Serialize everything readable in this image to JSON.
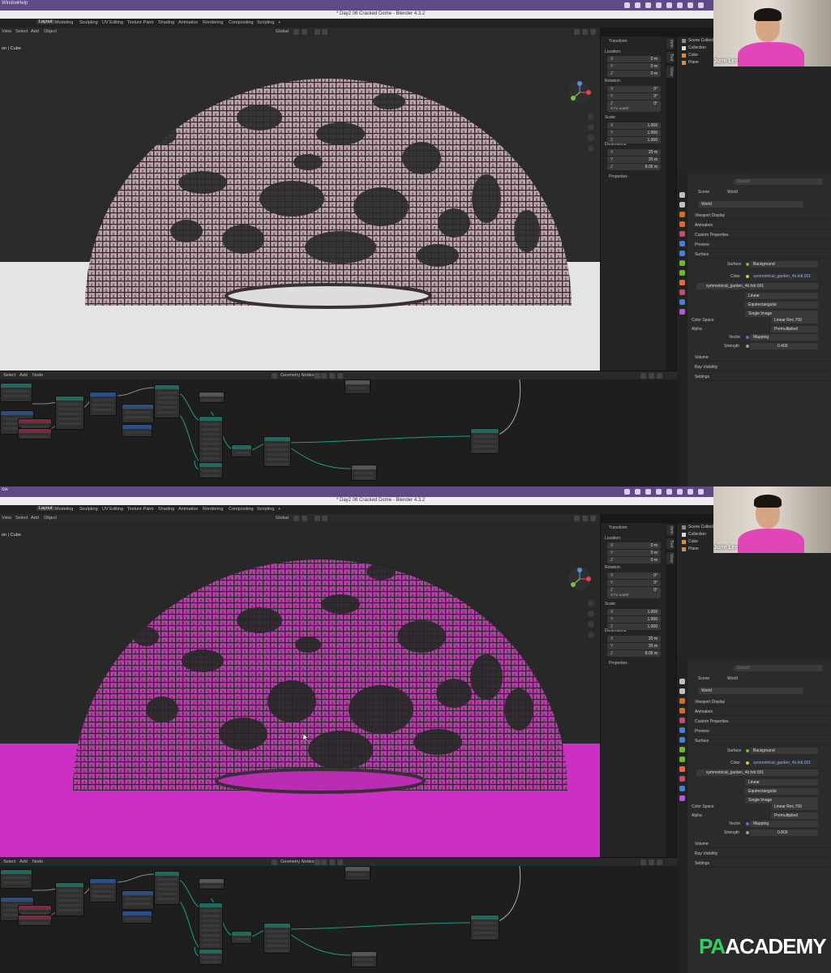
{
  "screens": [
    {
      "menu_left": "Window",
      "app_menu": "Help",
      "window_title": "* Day2 06 Cracked Dome - Blender 4.3.2",
      "workspace_tabs": [
        "Layout",
        "Modeling",
        "Sculpting",
        "UV Editing",
        "Texture Paint",
        "Shading",
        "Animation",
        "Rendering",
        "Compositing",
        "Scripting",
        "+"
      ],
      "view_menu": [
        "View",
        "Select",
        "Add",
        "Object"
      ],
      "orientation": "Global",
      "viewport_label": "on | Cube",
      "transform": {
        "title": "Transform",
        "location_label": "Location:",
        "location": [
          {
            "axis": "X",
            "value": "0 m"
          },
          {
            "axis": "Y",
            "value": "0 m"
          },
          {
            "axis": "Z",
            "value": "0 m"
          }
        ],
        "rotation_label": "Rotation:",
        "rotation": [
          {
            "axis": "X",
            "value": "0°"
          },
          {
            "axis": "Y",
            "value": "0°"
          },
          {
            "axis": "Z",
            "value": "0°"
          }
        ],
        "rotation_mode": "XYZ Euler",
        "scale_label": "Scale:",
        "scale": [
          {
            "axis": "X",
            "value": "1.000"
          },
          {
            "axis": "Y",
            "value": "1.000"
          },
          {
            "axis": "Z",
            "value": "1.000"
          }
        ],
        "dimensions_label": "Dimensions:",
        "dimensions": [
          {
            "axis": "X",
            "value": "20 m"
          },
          {
            "axis": "Y",
            "value": "20 m"
          },
          {
            "axis": "Z",
            "value": "8.05 m"
          }
        ],
        "properties": "Properties"
      },
      "side_tabs": [
        "Item",
        "Tool",
        "View"
      ],
      "outliner": [
        "Scene Collection",
        "Collection",
        "Cube",
        "Plane"
      ],
      "webcam_name": "June Lee",
      "props": {
        "search": "Search",
        "breadcrumb": [
          "Scene",
          "World"
        ],
        "world": "World",
        "sections": [
          "Viewport Display",
          "Animation",
          "Custom Properties",
          "Preview",
          "Surface"
        ],
        "surface_label": "Surface",
        "surface_value": "Background",
        "color_label": "Color",
        "color_value": "symmetrical_garden_4k.hdr.001",
        "image_name": "symmetrical_garden_4k.hdr.001",
        "interp": "Linear",
        "projection": "Equirectangular",
        "source": "Single Image",
        "color_space_label": "Color Space",
        "color_space": "Linear Rec.709",
        "alpha_label": "Alpha",
        "alpha": "Premultiplied",
        "vector_label": "Vector",
        "vector": "Mapping",
        "strength_label": "Strength",
        "strength": "0.400",
        "sections_after": [
          "Volume",
          "Ray Visibility",
          "Settings"
        ]
      },
      "node_menu": [
        "Select",
        "Add",
        "Node"
      ],
      "node_editor_type": "Geometry Nodes",
      "node_label_left": "Geometry Nodes",
      "dome_color": "#bba2a7",
      "ground_color": "#e4e4e6"
    },
    {
      "menu_left": "ow",
      "app_menu": "",
      "window_title": "* Day2 06 Cracked Dome - Blender 4.3.2",
      "workspace_tabs": [
        "Layout",
        "Modeling",
        "Sculpting",
        "UV Editing",
        "Texture Paint",
        "Shading",
        "Animation",
        "Rendering",
        "Compositing",
        "Scripting",
        "+"
      ],
      "view_menu": [
        "View",
        "Select",
        "Add",
        "Object"
      ],
      "orientation": "Global",
      "viewport_label": "on | Cube",
      "transform": {
        "title": "Transform",
        "location_label": "Location:",
        "location": [
          {
            "axis": "X",
            "value": "0 m"
          },
          {
            "axis": "Y",
            "value": "0 m"
          },
          {
            "axis": "Z",
            "value": "0 m"
          }
        ],
        "rotation_label": "Rotation:",
        "rotation": [
          {
            "axis": "X",
            "value": "0°"
          },
          {
            "axis": "Y",
            "value": "0°"
          },
          {
            "axis": "Z",
            "value": "0°"
          }
        ],
        "rotation_mode": "XYZ Euler",
        "scale_label": "Scale:",
        "scale": [
          {
            "axis": "X",
            "value": "1.000"
          },
          {
            "axis": "Y",
            "value": "1.000"
          },
          {
            "axis": "Z",
            "value": "1.000"
          }
        ],
        "dimensions_label": "Dimensions:",
        "dimensions": [
          {
            "axis": "X",
            "value": "20 m"
          },
          {
            "axis": "Y",
            "value": "20 m"
          },
          {
            "axis": "Z",
            "value": "8.05 m"
          }
        ],
        "properties": "Properties"
      },
      "side_tabs": [
        "Item",
        "Tool",
        "View"
      ],
      "outliner": [
        "Scene Collection",
        "Collection",
        "Cube",
        "Plane"
      ],
      "webcam_name": "June Lee",
      "props": {
        "search": "Search",
        "breadcrumb": [
          "Scene",
          "World"
        ],
        "world": "World",
        "sections": [
          "Viewport Display",
          "Animation",
          "Custom Properties",
          "Preview",
          "Surface"
        ],
        "surface_label": "Surface",
        "surface_value": "Background",
        "color_label": "Color",
        "color_value": "symmetrical_garden_4k.hdr.001",
        "image_name": "symmetrical_garden_4k.hdr.001",
        "interp": "Linear",
        "projection": "Equirectangular",
        "source": "Single Image",
        "color_space_label": "Color Space",
        "color_space": "Linear Rec.709",
        "alpha_label": "Alpha",
        "alpha": "Premultiplied",
        "vector_label": "Vector",
        "vector": "Mapping",
        "strength_label": "Strength",
        "strength": "0.800",
        "sections_after": [
          "Volume",
          "Ray Visibility",
          "Settings"
        ]
      },
      "node_menu": [
        "Select",
        "Add",
        "Node"
      ],
      "node_editor_type": "Geometry Nodes",
      "node_label_left": "Geometry Nodes",
      "dome_color": "#b43fa9",
      "ground_color": "#cc2fc4"
    }
  ],
  "watermark": {
    "pa": "PA",
    "rest": "ACADEMY"
  }
}
